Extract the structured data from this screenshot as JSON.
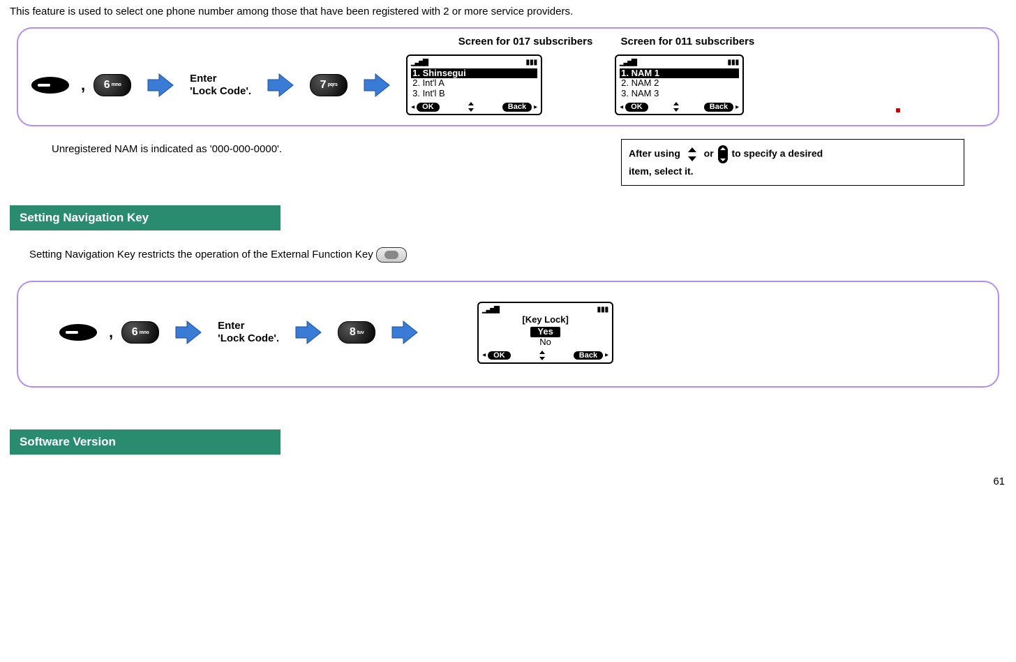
{
  "intro": "This feature is used to select one phone number among those that have been registered with 2 or more service providers.",
  "panel1": {
    "label017": "Screen for 017 subscribers",
    "label011": "Screen for 011 subscribers",
    "step_text": "Enter\n'Lock Code'.",
    "key1_digit": "6",
    "key1_letters": "mno",
    "key2_digit": "7",
    "key2_letters": "pqrs",
    "screen017": {
      "items": [
        "1. Shinsegui",
        "2. Int'l A",
        "3. Int'l B"
      ],
      "ok": "OK",
      "back": "Back"
    },
    "screen011": {
      "items": [
        "1. NAM 1",
        "2. NAM 2",
        "3. NAM 3"
      ],
      "ok": "OK",
      "back": "Back"
    }
  },
  "note_left": "Unregistered NAM is indicated as '000-000-0000'.",
  "note_right_parts": {
    "a": "After using",
    "b": "or",
    "c": "to specify  a desired",
    "d": "item, select it."
  },
  "sect_nav": "Setting Navigation Key",
  "nav_body": "Setting Navigation Key restricts the operation of the External Function Key",
  "panel2": {
    "step_text": "Enter\n'Lock Code'.",
    "key1_digit": "6",
    "key1_letters": "mno",
    "key2_digit": "8",
    "key2_letters": "tuv",
    "screen": {
      "title": "[Key Lock]",
      "opt_sel": "Yes",
      "opt_other": "No",
      "ok": "OK",
      "back": "Back"
    }
  },
  "sect_sw": "Software Version",
  "page": "61"
}
